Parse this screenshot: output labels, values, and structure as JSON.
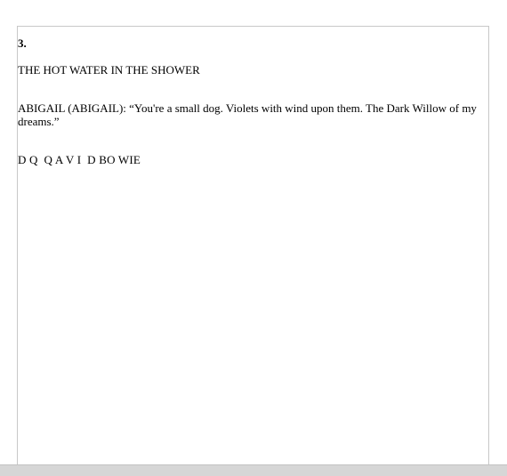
{
  "document": {
    "section_number": "3.",
    "scene_heading": "THE HOT WATER IN THE SHOWER",
    "dialogue": "ABIGAIL (ABIGAIL): “You're a small dog. Violets with wind upon them. The Dark Willow of my dreams.”",
    "code_line": "D Q  Q A V I  D BO WIE"
  }
}
